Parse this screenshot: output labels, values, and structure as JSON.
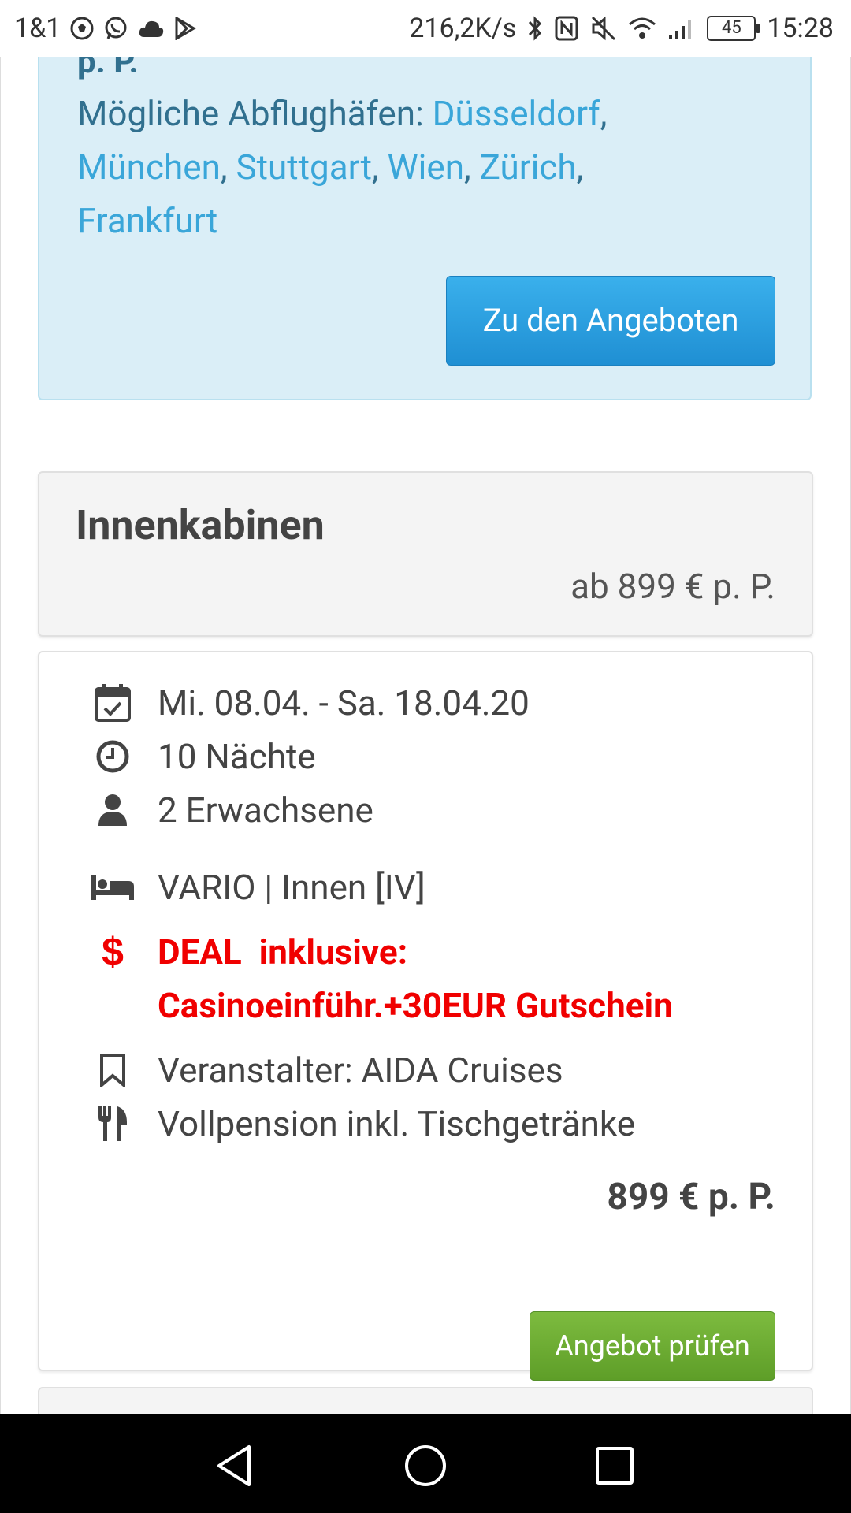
{
  "status_bar": {
    "carrier": "1&1",
    "speed": "216,2K/s",
    "battery": "45",
    "time": "15:28"
  },
  "blue_box": {
    "price_suffix": "p. P.",
    "airports_label": "Mögliche Abflughäfen:",
    "airports": [
      "Düsseldorf",
      "München",
      "Stuttgart",
      "Wien",
      "Zürich",
      "Frankfurt"
    ],
    "button_label": "Zu den Angeboten"
  },
  "cabin": {
    "title": "Innenkabinen",
    "from_price": "ab 899 € p. P."
  },
  "offer": {
    "date_range": "Mi. 08.04. - Sa. 18.04.20",
    "nights": "10 Nächte",
    "travellers": "2 Erwachsene",
    "room": "VARIO | Innen [IV]",
    "deal_line1": "DEAL  inklusive:",
    "deal_line2": "Casinoeinführ.+30EUR Gutschein",
    "operator": "Veranstalter: AIDA Cruises",
    "board": "Vollpension inkl. Tischgetränke",
    "price": "899 € p. P.",
    "button_label": "Angebot prüfen"
  },
  "colors": {
    "info_bg": "#daeef7",
    "link": "#3aa6d9",
    "info_text": "#31708f",
    "primary_button": "#2a9fe2",
    "success_button": "#6aab33",
    "deal_red": "#f00000"
  },
  "icons": {
    "date": "calendar-check-icon",
    "nights": "clock-icon",
    "travellers": "user-icon",
    "room": "bed-icon",
    "deal": "dollar-icon",
    "operator": "bookmark-icon",
    "board": "cutlery-icon"
  }
}
